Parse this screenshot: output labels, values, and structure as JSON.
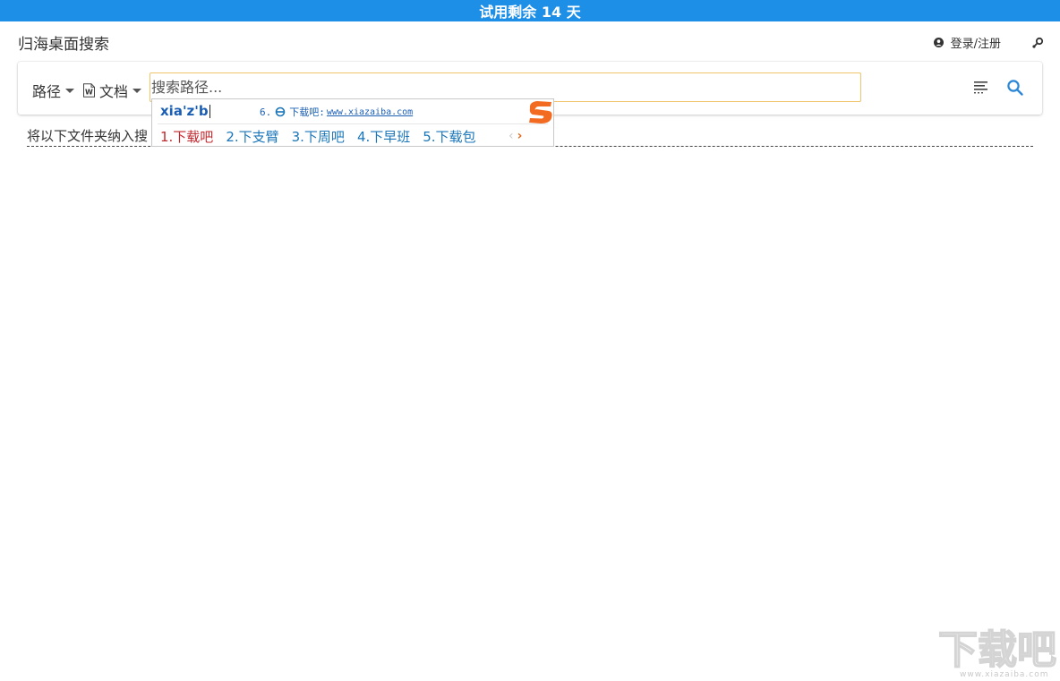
{
  "trial_banner": "试用剩余 14 天",
  "app": {
    "title": "归海桌面搜索"
  },
  "header": {
    "login_label": "登录/注册"
  },
  "toolbar": {
    "path_label": "路径",
    "type_label": "文档",
    "search_placeholder": "搜索路径..."
  },
  "folders": {
    "label": "将以下文件夹纳入搜"
  },
  "ime": {
    "input": "xia'z'b",
    "hint_index": "6.",
    "hint_text": "下载吧:",
    "hint_url": "www.xiazaiba.com",
    "candidates": [
      "1.下载吧",
      "2.下支臂",
      "3.下周吧",
      "4.下早班",
      "5.下载包"
    ],
    "prev_symbol": "‹",
    "next_symbol": "›"
  },
  "watermark": {
    "text": "下载吧",
    "url": "www.xiazaiba.com"
  },
  "colors": {
    "banner": "#1e8fe6",
    "accent": "#1a76b8",
    "input_border": "#efc46a",
    "first_candidate": "#c0282e"
  }
}
